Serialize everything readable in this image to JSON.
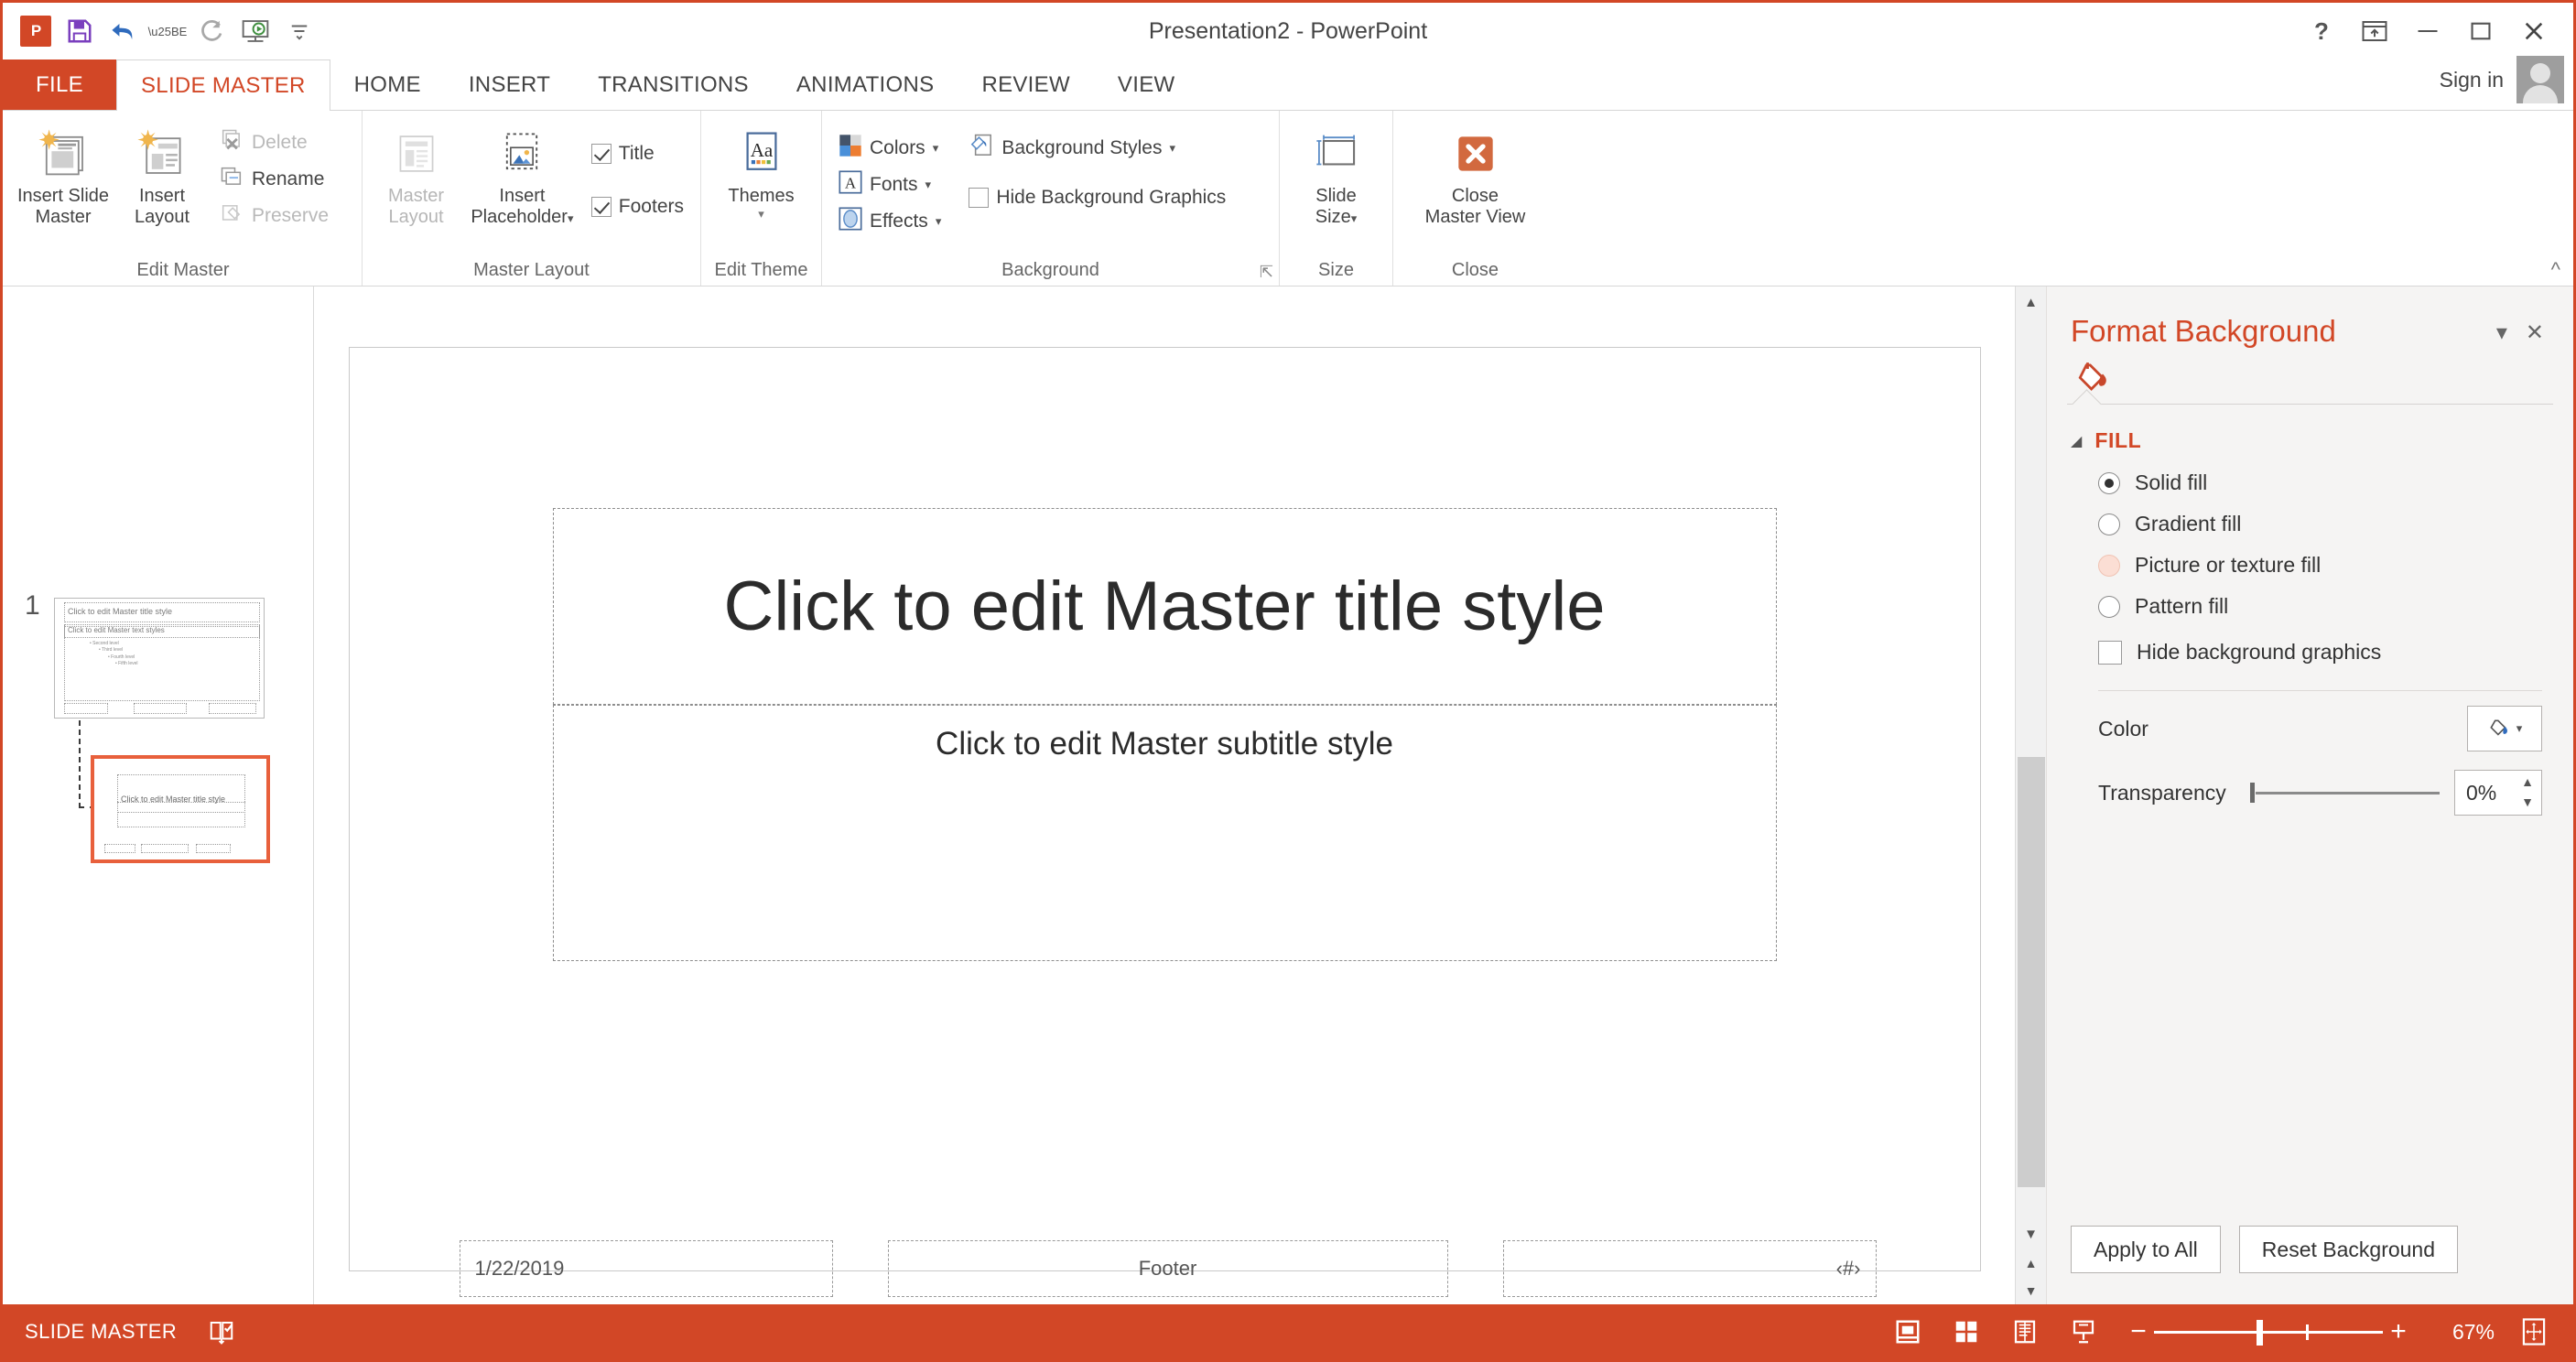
{
  "window": {
    "title": "Presentation2 - PowerPoint",
    "quick_access": [
      {
        "name": "save-icon",
        "glyph": "ὋE"
      },
      {
        "name": "undo-icon",
        "glyph": "↶"
      },
      {
        "name": "redo-icon",
        "glyph": "↻"
      },
      {
        "name": "start-slideshow-icon",
        "glyph": "▶"
      },
      {
        "name": "customize-qat-icon",
        "glyph": "▾"
      }
    ],
    "help_label": "?",
    "ribbon_display_label": "⬆",
    "minimize_label": "—",
    "restore_label": "❐",
    "close_label": "✕",
    "signin_label": "Sign in",
    "accent": "#d24726"
  },
  "tabs": {
    "file": "FILE",
    "items": [
      {
        "label": "SLIDE MASTER",
        "active": true
      },
      {
        "label": "HOME",
        "active": false
      },
      {
        "label": "INSERT",
        "active": false
      },
      {
        "label": "TRANSITIONS",
        "active": false
      },
      {
        "label": "ANIMATIONS",
        "active": false
      },
      {
        "label": "REVIEW",
        "active": false
      },
      {
        "label": "VIEW",
        "active": false
      }
    ]
  },
  "ribbon": {
    "collapse_label": "⌃",
    "groups": [
      {
        "label": "Edit Master",
        "big_buttons": [
          {
            "name": "insert-slide-master-button",
            "line1": "Insert Slide",
            "line2": "Master"
          },
          {
            "name": "insert-layout-button",
            "line1": "Insert",
            "line2": "Layout"
          }
        ],
        "small_buttons": [
          {
            "name": "delete-button",
            "label": "Delete",
            "disabled": true
          },
          {
            "name": "rename-button",
            "label": "Rename",
            "disabled": false
          },
          {
            "name": "preserve-button",
            "label": "Preserve",
            "disabled": true
          }
        ]
      },
      {
        "label": "Master Layout",
        "big_buttons": [
          {
            "name": "master-layout-button",
            "line1": "Master",
            "line2": "Layout",
            "disabled": true
          },
          {
            "name": "insert-placeholder-button",
            "line1": "Insert",
            "line2": "Placeholder",
            "caret": true
          }
        ],
        "checkboxes": [
          {
            "name": "title-checkbox",
            "label": "Title",
            "checked": true
          },
          {
            "name": "footers-checkbox",
            "label": "Footers",
            "checked": true
          }
        ]
      },
      {
        "label": "Edit Theme",
        "big_buttons": [
          {
            "name": "themes-button",
            "line1": "Themes",
            "line2": "",
            "caret": true
          }
        ]
      },
      {
        "label": "Background",
        "small_buttons": [
          {
            "name": "colors-button",
            "label": "Colors",
            "caret": true
          },
          {
            "name": "fonts-button",
            "label": "Fonts",
            "caret": true
          },
          {
            "name": "effects-button",
            "label": "Effects",
            "caret": true
          },
          {
            "name": "background-styles-button",
            "label": "Background Styles",
            "caret": true
          },
          {
            "name": "hide-background-graphics-checkbox",
            "label": "Hide Background Graphics",
            "checked": false
          }
        ],
        "dialog_launcher": "⤡"
      },
      {
        "label": "Size",
        "big_buttons": [
          {
            "name": "slide-size-button",
            "line1": "Slide",
            "line2": "Size",
            "caret": true
          }
        ]
      },
      {
        "label": "Close",
        "big_buttons": [
          {
            "name": "close-master-view-button",
            "line1": "Close",
            "line2": "Master View"
          }
        ]
      }
    ]
  },
  "thumbnails": {
    "number": "1",
    "slide1_title": "Click to edit Master title style",
    "slide1_body": "Click to edit Master text styles",
    "slide2_title": "Click to edit Master title style"
  },
  "slide": {
    "title_placeholder": "Click to edit Master title style",
    "subtitle_placeholder": "Click to edit Master subtitle style",
    "date": "1/22/2019",
    "footer": "Footer",
    "slide_number": "‹#›"
  },
  "scrollbar": {
    "up": "▲",
    "down": "▼",
    "prev_slide": "▲",
    "next_slide": "▼",
    "fit": "▫"
  },
  "format_pane": {
    "title": "Format Background",
    "dropdown_label": "▾",
    "close_label": "✕",
    "fill_icon": "paint-bucket-icon",
    "section": "FILL",
    "section_triangle": "◢",
    "options": [
      {
        "name": "solid-fill-radio",
        "label": "Solid fill",
        "selected": true,
        "highlight": false
      },
      {
        "name": "gradient-fill-radio",
        "label": "Gradient fill",
        "selected": false,
        "highlight": false
      },
      {
        "name": "picture-or-texture-fill-radio",
        "label": "Picture or texture fill",
        "selected": false,
        "highlight": true
      },
      {
        "name": "pattern-fill-radio",
        "label": "Pattern fill",
        "selected": false,
        "highlight": false
      }
    ],
    "hide_background_graphics": {
      "label": "Hide background graphics",
      "checked": false
    },
    "color_label": "Color",
    "transparency_label": "Transparency",
    "transparency_value": "0%",
    "apply_to_all": "Apply to All",
    "reset_background": "Reset Background"
  },
  "status_bar": {
    "view_name": "SLIDE MASTER",
    "notes_icon": "notes-icon",
    "view_buttons": [
      {
        "name": "normal-view-button",
        "glyph": "normal"
      },
      {
        "name": "slide-sorter-button",
        "glyph": "sorter"
      },
      {
        "name": "reading-view-button",
        "glyph": "reading"
      },
      {
        "name": "slideshow-button",
        "glyph": "show"
      }
    ],
    "zoom_out": "−",
    "zoom_in": "+",
    "zoom_value": "67%",
    "fit_window": "fit-slide-to-window-icon"
  }
}
